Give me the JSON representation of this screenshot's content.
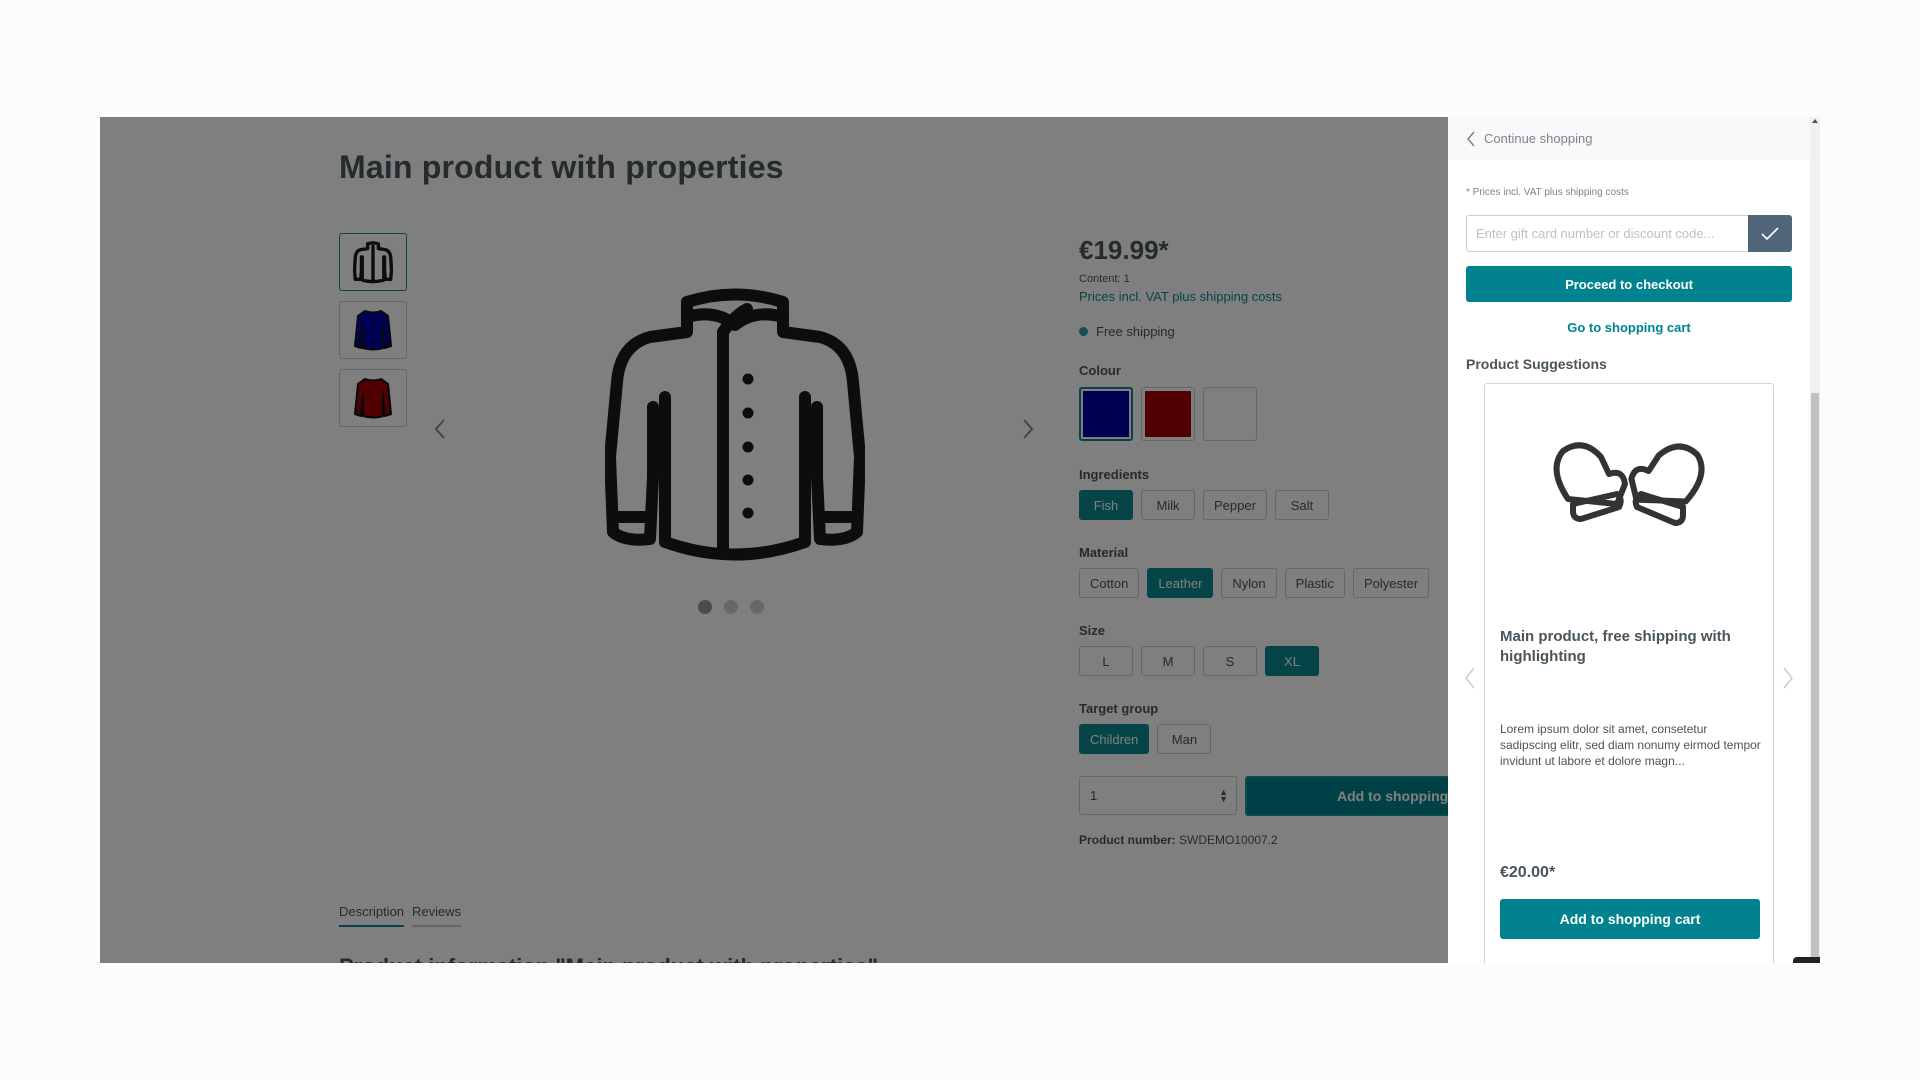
{
  "product": {
    "title": "Main product with properties",
    "price": "€19.99*",
    "content": "Content: 1",
    "vat_note": "Prices incl. VAT plus shipping costs",
    "shipping": "Free shipping",
    "product_number_label": "Product number:",
    "product_number": "SWDEMO10007.2",
    "quantity": "1",
    "add_to_cart_label": "Add to shopping cart",
    "gallery": {
      "thumbnails": [
        {
          "name": "jacket-outline",
          "color": "#ffffff"
        },
        {
          "name": "sweater-blue",
          "color": "#0000a0"
        },
        {
          "name": "sweater-red",
          "color": "#a00000"
        }
      ],
      "active_slide": 1,
      "slide_count": 3
    },
    "properties": {
      "colour": {
        "label": "Colour",
        "swatches": [
          {
            "name": "blue",
            "color": "#0000a0",
            "selected": true
          },
          {
            "name": "red",
            "color": "#a00000",
            "selected": false
          },
          {
            "name": "white",
            "color": "#ffffff",
            "selected": false
          }
        ]
      },
      "ingredients": {
        "label": "Ingredients",
        "options": [
          "Fish",
          "Milk",
          "Pepper",
          "Salt"
        ],
        "selected": "Fish"
      },
      "material": {
        "label": "Material",
        "options": [
          "Cotton",
          "Leather",
          "Nylon",
          "Plastic",
          "Polyester"
        ],
        "selected": "Leather"
      },
      "size": {
        "label": "Size",
        "options": [
          "L",
          "M",
          "S",
          "XL"
        ],
        "selected": "XL"
      },
      "target_group": {
        "label": "Target group",
        "options": [
          "Children",
          "Man"
        ],
        "selected": "Children"
      }
    },
    "tabs": [
      {
        "label": "Description",
        "active": true
      },
      {
        "label": "Reviews",
        "active": false
      }
    ],
    "description_heading": "Product information \"Main product with properties\""
  },
  "offcanvas": {
    "continue_label": "Continue shopping",
    "prices_note": "* Prices incl. VAT plus shipping costs",
    "voucher_placeholder": "Enter gift card number or discount code...",
    "checkout_label": "Proceed to checkout",
    "go_to_cart_label": "Go to shopping cart",
    "suggestions_title": "Product Suggestions",
    "suggestion": {
      "name": "Main product, free shipping with highlighting",
      "description": "Lorem ipsum dolor sit amet, consetetur sadipscing elitr, sed diam nonumy eirmod tempor invidunt ut labore et dolore magn...",
      "price": "€20.00*",
      "button_label": "Add to shopping cart"
    }
  },
  "colors": {
    "primary": "#00838f",
    "backdrop": "rgba(0,0,0,0.5)",
    "voucher_button": "#52667a"
  }
}
